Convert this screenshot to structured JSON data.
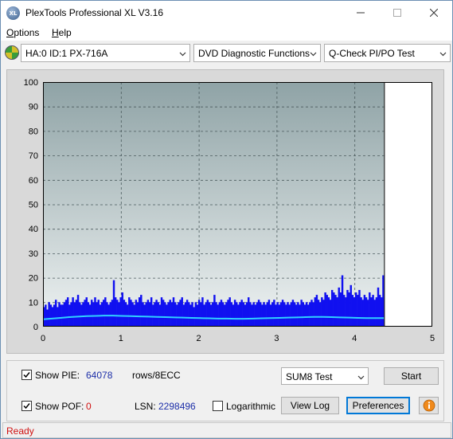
{
  "titlebar": {
    "title": "PlexTools Professional XL V3.16",
    "icon_text": "XL",
    "buttons": [
      "minimize-icon",
      "maximize-icon",
      "close-icon"
    ]
  },
  "menu": {
    "items": [
      {
        "label": "Options",
        "accel": "O",
        "rest": "ptions"
      },
      {
        "label": "Help",
        "accel": "H",
        "rest": "elp"
      }
    ]
  },
  "toolbar": {
    "drive": "HA:0 ID:1  PX-716A",
    "function": "DVD Diagnostic Functions",
    "test": "Q-Check PI/PO Test"
  },
  "chart_data": {
    "type": "bar",
    "title": "",
    "xlabel": "",
    "ylabel": "",
    "xlim": [
      0,
      5
    ],
    "ylim": [
      0,
      100
    ],
    "x_ticks": [
      "0",
      "1",
      "2",
      "3",
      "4",
      "5"
    ],
    "y_ticks": [
      "0",
      "10",
      "20",
      "30",
      "40",
      "50",
      "60",
      "70",
      "80",
      "90",
      "100"
    ],
    "grid": true,
    "end_marker_x": 4.38,
    "colors": {
      "plot_bg_top": "#8fa3a6",
      "plot_bg_bottom": "#eef2f2",
      "pie_bars": "#1010f0",
      "sum_line": "#30d0ff"
    },
    "series": [
      {
        "type": "bar",
        "x_start": 0,
        "x_end": 4.38,
        "values": [
          8,
          9,
          7,
          10,
          9,
          8,
          9,
          11,
          8,
          10,
          9,
          9,
          10,
          11,
          12,
          9,
          10,
          12,
          10,
          11,
          13,
          10,
          9,
          10,
          11,
          12,
          10,
          9,
          11,
          10,
          12,
          10,
          11,
          9,
          10,
          11,
          12,
          10,
          9,
          10,
          11,
          19,
          12,
          11,
          10,
          12,
          14,
          11,
          10,
          9,
          12,
          11,
          10,
          9,
          11,
          10,
          12,
          13,
          10,
          9,
          10,
          11,
          10,
          12,
          9,
          10,
          11,
          10,
          9,
          12,
          11,
          10,
          9,
          10,
          11,
          10,
          12,
          10,
          9,
          10,
          11,
          12,
          9,
          10,
          11,
          10,
          9,
          10,
          8,
          10,
          9,
          11,
          10,
          12,
          9,
          10,
          11,
          10,
          9,
          10,
          13,
          10,
          9,
          10,
          11,
          10,
          9,
          10,
          11,
          12,
          10,
          9,
          11,
          10,
          9,
          10,
          11,
          10,
          9,
          10,
          12,
          10,
          9,
          10,
          9,
          10,
          11,
          10,
          9,
          10,
          9,
          10,
          11,
          9,
          10,
          11,
          9,
          10,
          9,
          10,
          11,
          10,
          9,
          10,
          9,
          10,
          11,
          10,
          9,
          10,
          9,
          11,
          10,
          9,
          10,
          9,
          10,
          11,
          10,
          12,
          13,
          11,
          10,
          12,
          11,
          14,
          13,
          12,
          11,
          15,
          14,
          13,
          12,
          16,
          14,
          21,
          13,
          12,
          15,
          14,
          17,
          13,
          12,
          14,
          13,
          15,
          12,
          11,
          13,
          12,
          11,
          14,
          12,
          13,
          11,
          12,
          16,
          13,
          12,
          21
        ]
      },
      {
        "type": "line",
        "name": "",
        "x_start": 0,
        "x_end": 4.38,
        "values": [
          3,
          3.3,
          3.6,
          3.9,
          4.1,
          4.3,
          4.4,
          4.5,
          4.5,
          4.4,
          4.3,
          4.2,
          4.1,
          4.0,
          3.9,
          3.8,
          3.7,
          3.6,
          3.5,
          3.4,
          3.3,
          3.3,
          3.2,
          3.2,
          3.3,
          3.4,
          3.5,
          3.6,
          3.7,
          3.8,
          3.9,
          4.0,
          4.0,
          3.9,
          3.8,
          3.7,
          3.6,
          3.5,
          3.5,
          3.5
        ]
      }
    ]
  },
  "bottom": {
    "show_pie_label": "Show PIE:",
    "show_pie_accel": "I",
    "show_pie_checked": true,
    "pie_value": "64078",
    "pie_unit": "rows/8ECC",
    "show_pof_label": "Show POF:",
    "show_pof_checked": true,
    "pof_value": "0",
    "lsn_label": "LSN:",
    "lsn_value": "2298496",
    "logarithmic_label": "Logarithmic",
    "logarithmic_checked": false,
    "sum_test": "SUM8 Test",
    "start_label": "Start",
    "view_log_label": "View Log",
    "preferences_label": "Preferences",
    "info_icon": "info-icon"
  },
  "status": {
    "text": "Ready"
  }
}
